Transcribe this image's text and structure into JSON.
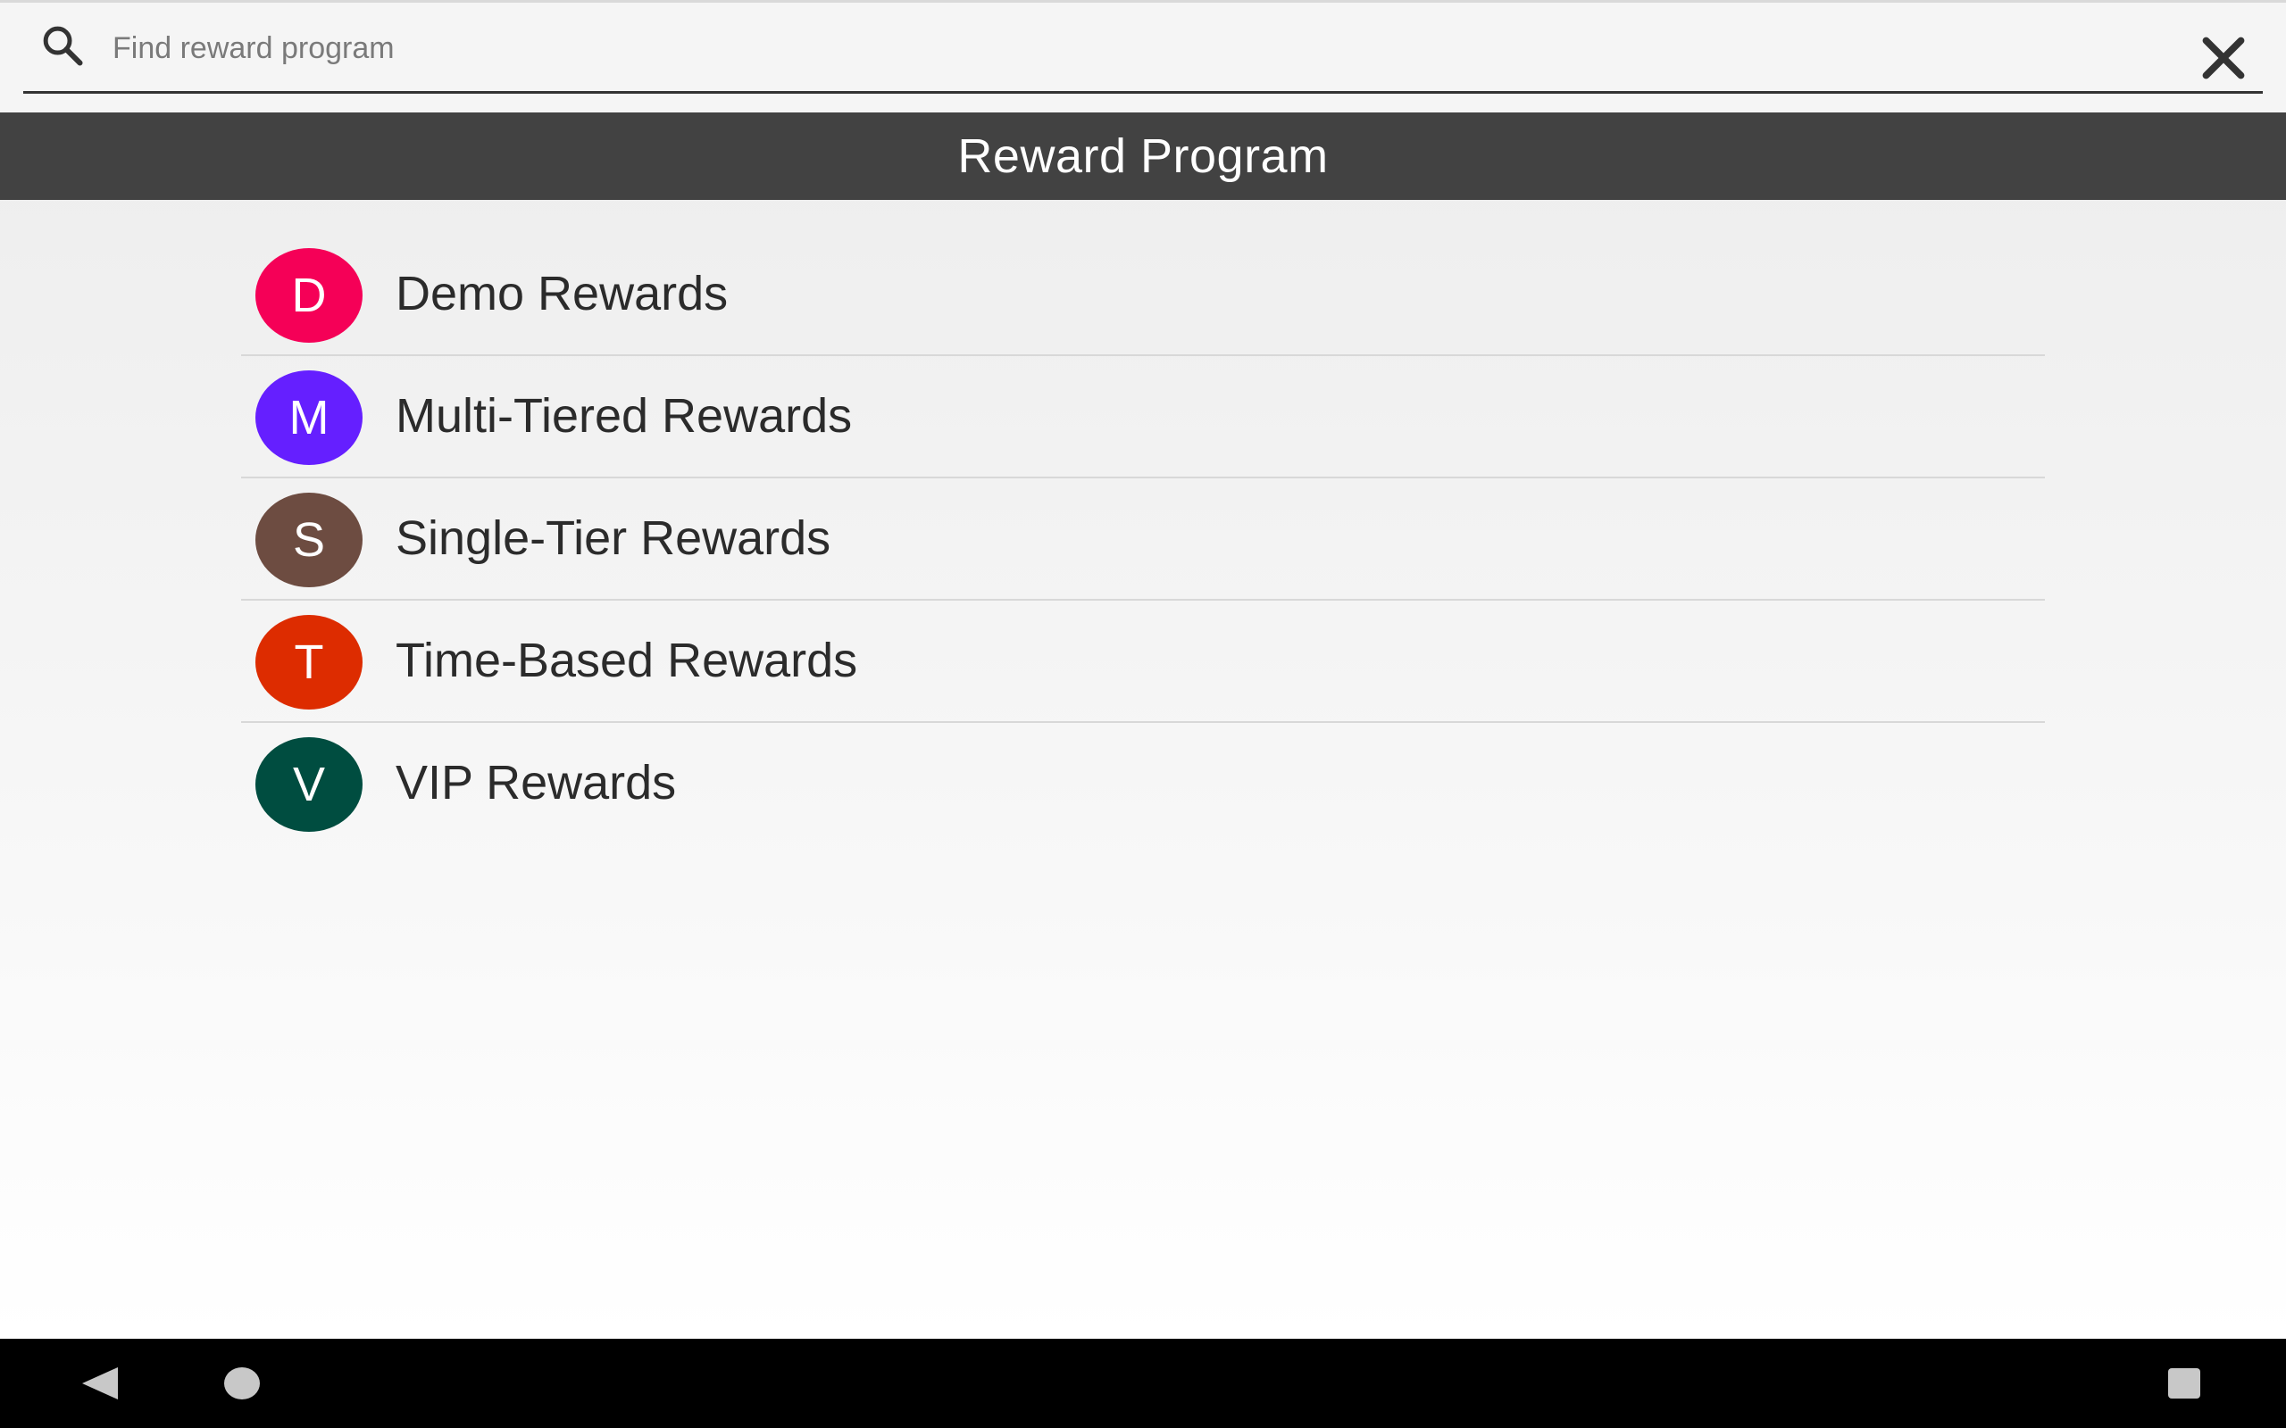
{
  "search": {
    "placeholder": "Find reward program",
    "value": "",
    "icon": "search-icon",
    "clear_icon": "close-icon"
  },
  "header": {
    "title": "Reward Program"
  },
  "programs": [
    {
      "initial": "D",
      "name": "Demo Rewards",
      "color": "#f50057"
    },
    {
      "initial": "M",
      "name": "Multi-Tiered Rewards",
      "color": "#651fff"
    },
    {
      "initial": "S",
      "name": "Single-Tier Rewards",
      "color": "#6d4c41"
    },
    {
      "initial": "T",
      "name": "Time-Based Rewards",
      "color": "#dd2c00"
    },
    {
      "initial": "V",
      "name": "VIP Rewards",
      "color": "#004d40"
    }
  ],
  "nav": {
    "back_icon": "back-triangle-icon",
    "home_icon": "home-circle-icon",
    "recents_icon": "recents-square-icon",
    "icon_color": "#c8c8c8"
  }
}
